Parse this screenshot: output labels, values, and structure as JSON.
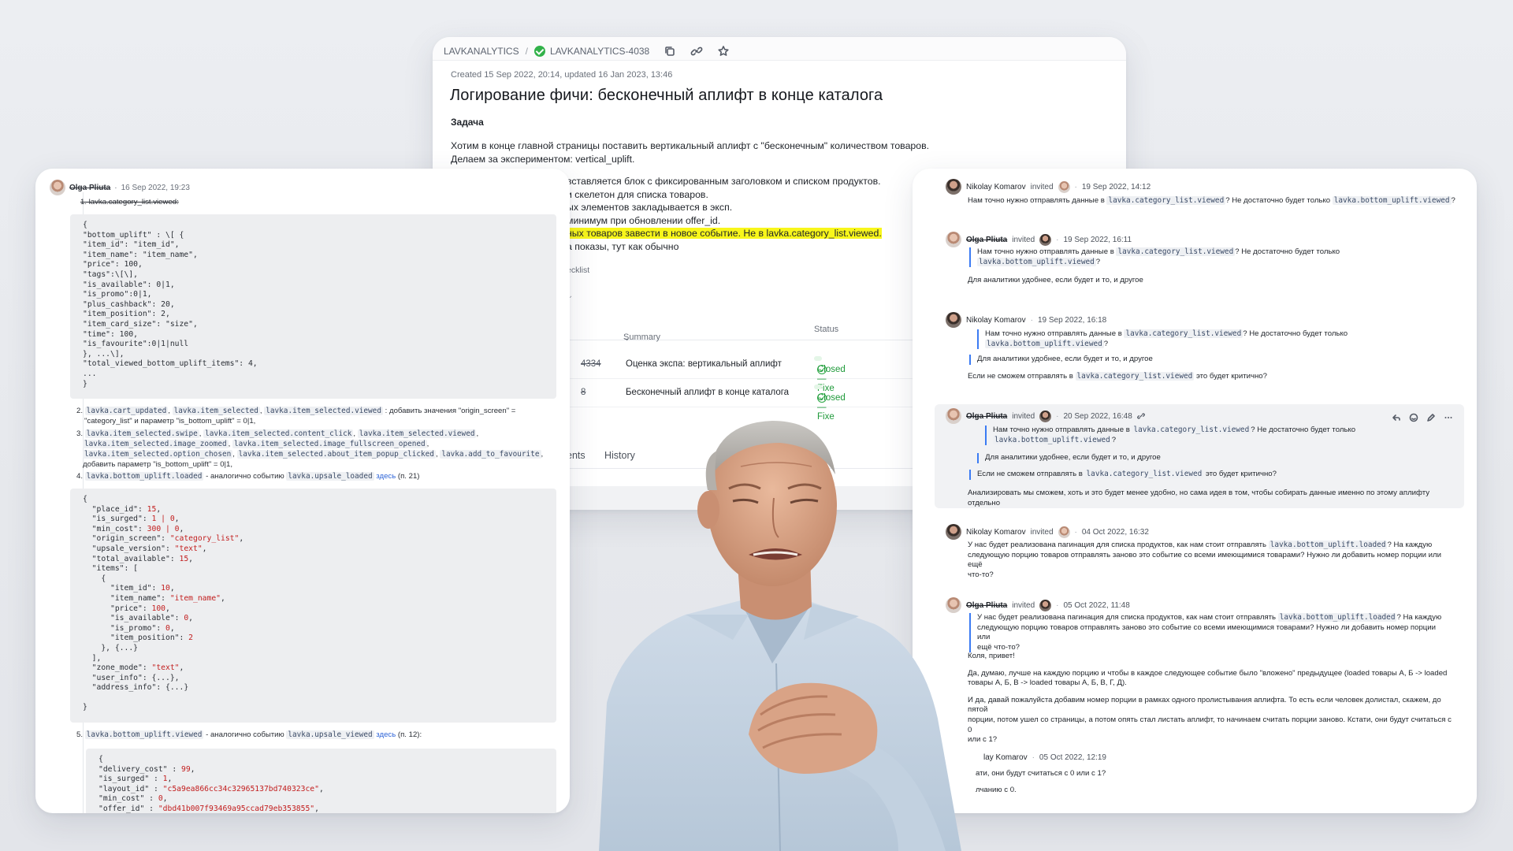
{
  "tracker": {
    "breadcrumb_queue": "LAVKANALYTICS",
    "breadcrumb_sep": "/",
    "issue_key": "LAVKANALYTICS-4038",
    "meta": "Created 15 Sep 2022, 20:14, updated 16 Jan 2023, 13:46",
    "title": "Логирование фичи: бесконечный аплифт в конце каталога",
    "section": "Задача",
    "desc_lines": [
      "Хотим в конце главной страницы поставить вертикальный аплифт с \"бесконечным\" количеством товаров.",
      "Делаем за экспериментом: vertical_uplift."
    ],
    "partial_lines": [
      "вставляется блок с фиксированным заголовком и списком продуктов.",
      "и скелетон для списка товаров.",
      "ых элементов закладывается в эксп.",
      "минимум при обновлении offer_id.",
      "ных товаров завести в новое событие. Не в lavka.category_list.viewed.",
      "а показы, тут как обычно"
    ],
    "checklist": "ecklist",
    "table": {
      "col_summary": "Summary",
      "col_summary_arrow": "⌄",
      "col_status": "Status",
      "rows": [
        {
          "key": "4334",
          "summary": "Оценка экспа: вертикальный аплифт",
          "status": "Closed — Fixe"
        },
        {
          "key": "8",
          "summary": "Бесконечный аплифт в конце каталога",
          "status": "Closed — Fixe"
        }
      ]
    },
    "tabs": [
      "ents",
      "History"
    ]
  },
  "left": {
    "author": "Olga Pliuta",
    "date": "16 Sep 2022, 19:23",
    "item1": "1. lavka.category_list.viewed:",
    "code1": [
      "{",
      "\"bottom_uplift\" : \\[ {",
      "\"item_id\": \"item_id\",",
      "\"item_name\": \"item_name\",",
      "\"price\": 100,",
      "\"tags\":\\[\\],",
      "\"is_available\": 0|1,",
      "\"is_promo\":0|1,",
      "\"plus_cashback\": 20,",
      "\"item_position\": 2,",
      "\"item_card_size\": \"size\",",
      "\"time\": 100,",
      "\"is_favourite\":0|1|null",
      "}, ...\\],",
      "\"total_viewed_bottom_uplift_items\": 4,",
      "...",
      "}"
    ],
    "item2_codes": [
      "lavka.cart_updated",
      "lavka.item_selected",
      "lavka.item_selected.viewed"
    ],
    "item2_text": ": добавить значения \"origin_screen\" =",
    "item2_text2": "\"category_list\" и параметр \"is_bottom_uplift\" = 0|1,",
    "item3_codes": [
      "lavka.item_selected.swipe",
      "lavka.item_selected.content_click",
      "lavka.item_selected.viewed",
      "lavka.item_selected.image_zoomed",
      "lavka.item_selected.image_fullscreen_opened",
      "lavka.item_selected.option_chosen",
      "lavka.item_selected.about_item_popup_clicked",
      "lavka.add_to_favourite"
    ],
    "item3_text": "добавить параметр \"is_bottom_uplift\" = 0|1,",
    "item4_code": "lavka.bottom_uplift.loaded",
    "item4_text": "- аналогично событию",
    "item4_code2": "lavka.upsale_loaded",
    "item4_link": "здесь",
    "item4_tail": "(п. 21)",
    "item5_code": "lavka.bottom_uplift.viewed",
    "item5_text": "- аналогично событию",
    "item5_code2": "lavka.upsale_viewed",
    "item5_link": "здесь",
    "item5_tail": "(п. 12):",
    "code2": [
      "{",
      "  \"place_id\": 15,",
      "  \"is_surged\": 1 | 0,",
      "  \"min_cost\": 300 | 0,",
      "  \"origin_screen\": \"category_list\",",
      "  \"upsale_version\": \"text\",",
      "  \"total_available\": 15,",
      "  \"items\": [",
      "    {",
      "      \"item_id\": 10,",
      "      \"item_name\": \"item_name\",",
      "      \"price\": 100,",
      "      \"is_available\": 0,",
      "      \"is_promo\": 0,",
      "      \"item_position\": 2",
      "    }, {...}",
      "  ],",
      "  \"zone_mode\": \"text\",",
      "  \"user_info\": {...},",
      "  \"address_info\": {...}",
      "",
      "}"
    ],
    "code3": [
      "{",
      "\"delivery_cost\" : 99,",
      "\"is_surged\" : 1,",
      "\"layout_id\" : \"c5a9ea866cc34c32965137bd740323ce\",",
      "\"min_cost\" : 0,",
      "\"offer_id\" : \"dbd41b007f93469a95ccad79eb353855\","
    ]
  },
  "right": {
    "invited": "invited",
    "comments": [
      {
        "author": "Nikolay Komarov",
        "strike": false,
        "date": "19 Sep 2022, 14:12",
        "text": [
          "Нам точно нужно отправлять данные в ",
          "lavka.category_list.viewed",
          "? Не достаточно будет только ",
          "lavka.bottom_uplift.viewed",
          "?"
        ]
      },
      {
        "author": "Olga Pliuta",
        "strike": true,
        "date": "19 Sep 2022, 16:11",
        "quote": [
          "Нам точно нужно отправлять данные в ",
          "lavka.category_list.viewed",
          "? Не достаточно будет только",
          "lavka.bottom_uplift.viewed",
          "?"
        ],
        "text": "Для аналитики удобнее, если будет и то, и другое"
      },
      {
        "author": "Nikolay Komarov",
        "strike": false,
        "date": "19 Sep 2022, 16:18",
        "quote": [
          "Нам точно нужно отправлять данные в ",
          "lavka.category_list.viewed",
          "? Не достаточно будет только",
          "lavka.bottom_uplift.viewed",
          "?"
        ],
        "quote2": "Для аналитики удобнее, если будет и то, и другое",
        "text": [
          "Если не сможем отправлять в ",
          "lavka.category_list.viewed",
          " это будет критично?"
        ]
      },
      {
        "author": "Olga Pliuta",
        "strike": true,
        "date": "20 Sep 2022, 16:48",
        "quote": [
          "Нам точно нужно отправлять данные в ",
          "lavka.category_list.viewed",
          "? Не достаточно будет только",
          "lavka.bottom_uplift.viewed",
          "?"
        ],
        "quote2": "Для аналитики удобнее, если будет и то, и другое",
        "quote3": [
          "Если не сможем отправлять в ",
          "lavka.category_list.viewed",
          " это будет критично?"
        ],
        "text": "Анализировать мы сможем, хоть и это будет менее удобно, но сама идея в том, чтобы собирать данные именно по этому аплифту отдельно"
      },
      {
        "author": "Nikolay Komarov",
        "strike": false,
        "date": "04 Oct 2022, 16:32",
        "text": [
          "У нас будет реализована пагинация для списка продуктов, как нам стоит отправлять ",
          "lavka.bottom_uplift.loaded",
          "? На каждую",
          "следующую порцию товаров отправлять заново это событие со всеми имеющимися товарами? Нужно ли добавить номер порции или ещё",
          "что-то?"
        ]
      },
      {
        "author": "Olga Pliuta",
        "strike": true,
        "date": "05 Oct 2022, 11:48",
        "quote": [
          "У нас будет реализована пагинация для списка продуктов, как нам стоит отправлять ",
          "lavka.bottom_uplift.loaded",
          "? На каждую",
          "следующую порцию товаров отправлять заново это событие со всеми имеющимися товарами? Нужно ли добавить номер порции или",
          "ещё что-то?"
        ],
        "text1": "Коля, привет!",
        "text2": "Да, думаю, лучше на каждую порцию и чтобы в каждое следующее событие было \"вложено\" предыдущее (loaded товары А, Б -> loaded",
        "text3": "товары А, Б, В -> loaded товары А, Б, В, Г, Д).",
        "text4": "И да, давай пожалуйста добавим номер порции в рамках одного пролистывания аплифта. То есть если человек долистал, скажем, до пятой",
        "text5": "порции, потом ушел со страницы, а потом опять стал листать аплифт, то начинаем считать порции заново. Кстати, они будут считаться с 0",
        "text6": "или с 1?"
      },
      {
        "author": "lay Komarov",
        "strike": false,
        "date": "05 Oct 2022, 12:19",
        "text1": "ати, они будут считаться с 0 или с 1?",
        "text2": "лчанию с 0."
      }
    ]
  }
}
